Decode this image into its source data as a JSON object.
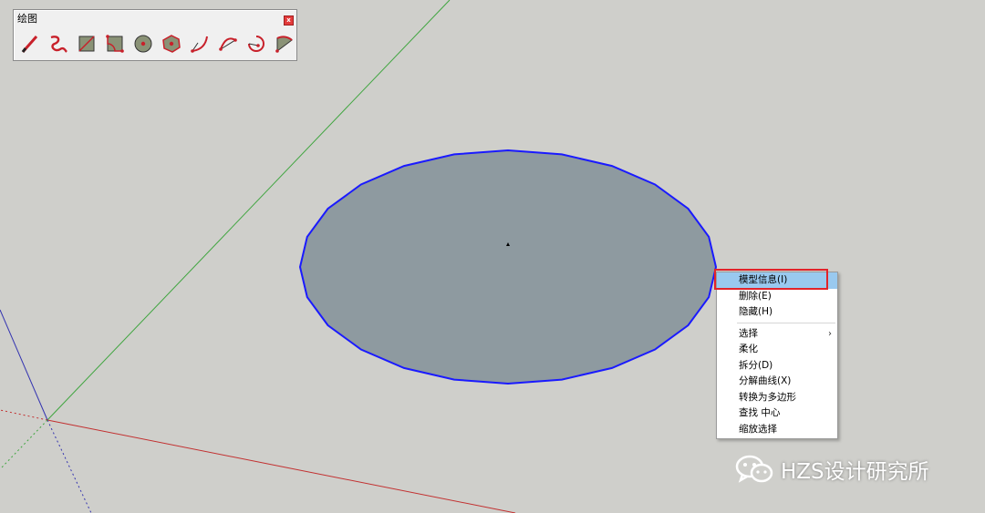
{
  "toolbar": {
    "title": "绘图",
    "close_glyph": "x",
    "tools": [
      {
        "icon": "pencil-line-icon"
      },
      {
        "icon": "freehand-icon"
      },
      {
        "icon": "rectangle-icon"
      },
      {
        "icon": "rotated-rectangle-icon"
      },
      {
        "icon": "circle-icon"
      },
      {
        "icon": "polygon-icon"
      },
      {
        "icon": "arc-icon"
      },
      {
        "icon": "two-point-arc-icon"
      },
      {
        "icon": "three-point-arc-icon"
      },
      {
        "icon": "pie-icon"
      }
    ]
  },
  "context_menu": {
    "items": [
      {
        "label": "模型信息(I)",
        "active": true
      },
      {
        "label": "删除(E)"
      },
      {
        "label": "隐藏(H)"
      },
      {
        "separator": true
      },
      {
        "label": "选择",
        "submenu": true
      },
      {
        "label": "柔化"
      },
      {
        "label": "拆分(D)"
      },
      {
        "label": "分解曲线(X)"
      },
      {
        "label": "转换为多边形"
      },
      {
        "label": "查找 中心"
      },
      {
        "label": "缩放选择"
      }
    ],
    "submenu_glyph": "›"
  },
  "watermark": {
    "text": "HZS设计研究所",
    "icon": "wechat-icon"
  },
  "colors": {
    "background": "#cfcfcb",
    "face_fill": "#8e9aa0",
    "circle_edge": "#1a1aff",
    "green_axis": "#3fa53f",
    "red_axis": "#c23030",
    "blue_axis": "#3434b0",
    "menu_active": "#99c9ef",
    "highlight_box": "#e2232a"
  }
}
